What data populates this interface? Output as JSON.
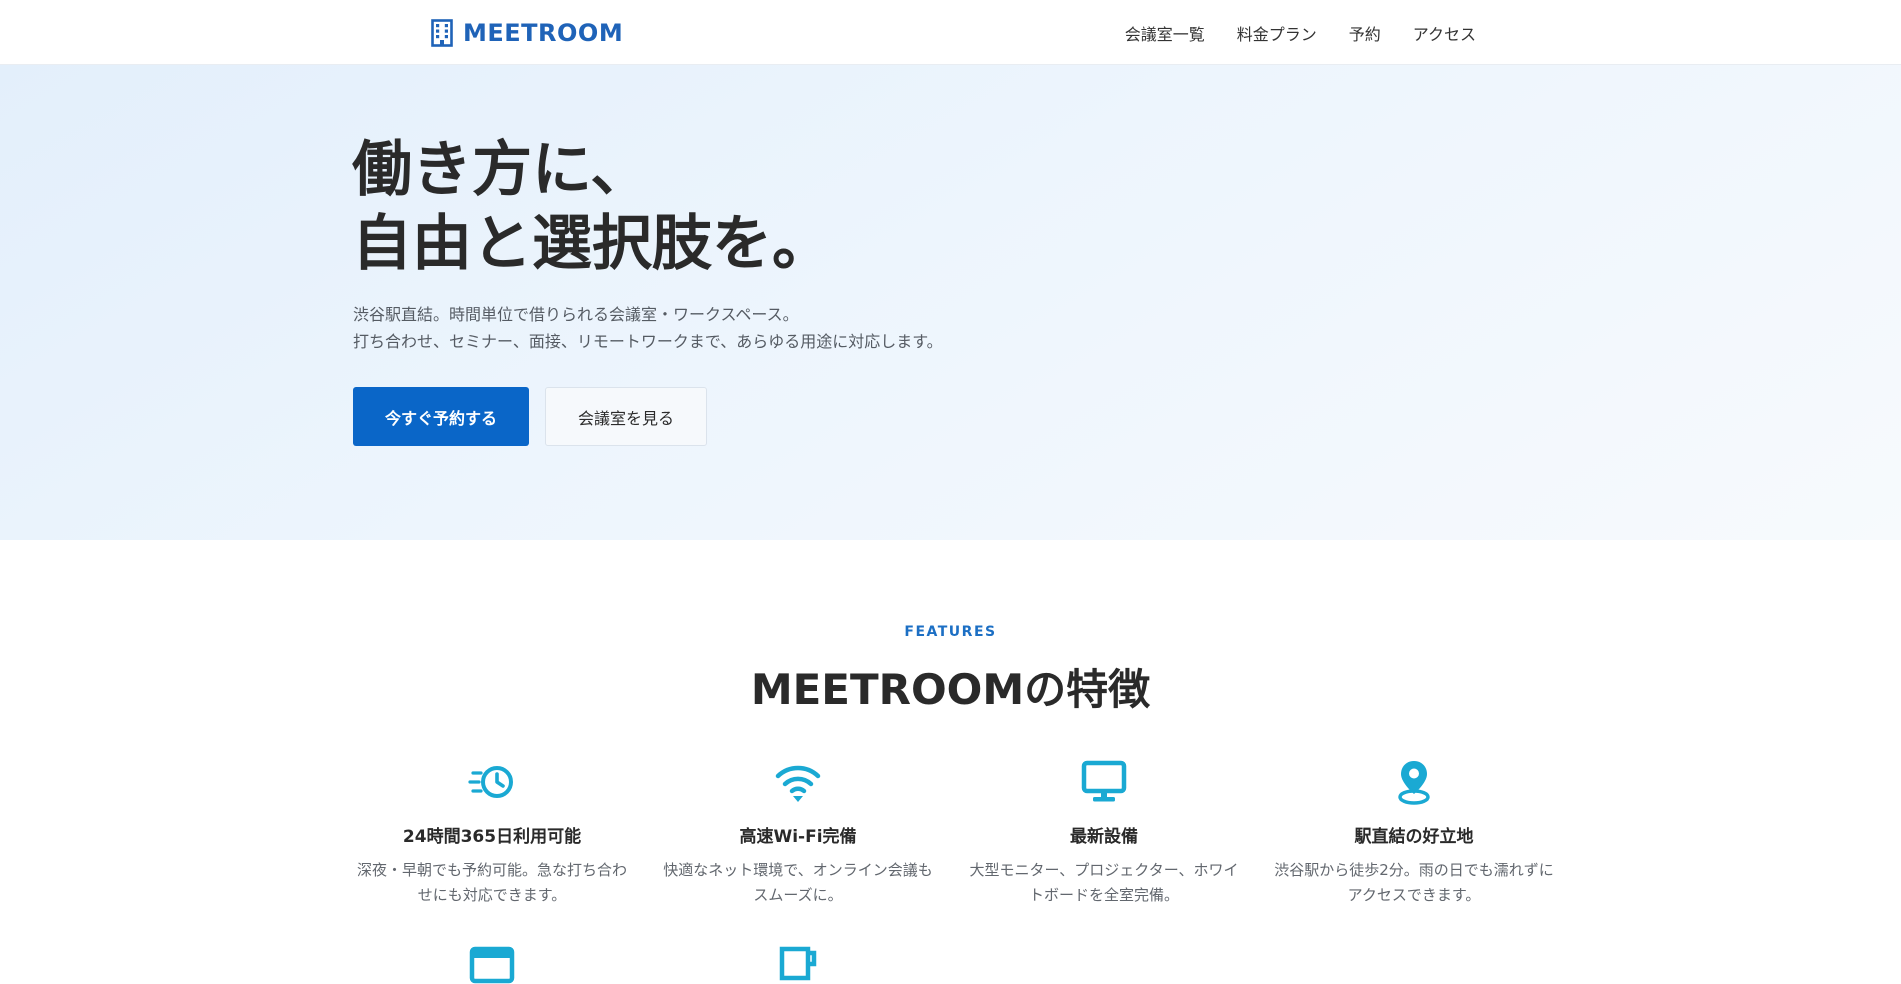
{
  "header": {
    "logo_text": "MEETROOM",
    "nav": [
      "会議室一覧",
      "料金プラン",
      "予約",
      "アクセス"
    ]
  },
  "hero": {
    "title_line1": "働き方に、",
    "title_line2": "自由と選択肢を。",
    "desc_line1": "渋谷駅直結。時間単位で借りられる会議室・ワークスペース。",
    "desc_line2": "打ち合わせ、セミナー、面接、リモートワークまで、あらゆる用途に対応します。",
    "primary_button": "今すぐ予約する",
    "secondary_button": "会議室を見る"
  },
  "features": {
    "eyebrow": "FEATURES",
    "title": "MEETROOMの特徴",
    "items": [
      {
        "icon": "fast-clock-icon",
        "name": "24時間365日利用可能",
        "desc": "深夜・早朝でも予約可能。急な打ち合わせにも対応できます。"
      },
      {
        "icon": "wifi-icon",
        "name": "高速Wi-Fi完備",
        "desc": "快適なネット環境で、オンライン会議もスムーズに。"
      },
      {
        "icon": "monitor-icon",
        "name": "最新設備",
        "desc": "大型モニター、プロジェクター、ホワイトボードを全室完備。"
      },
      {
        "icon": "map-pin-icon",
        "name": "駅直結の好立地",
        "desc": "渋谷駅から徒歩2分。雨の日でも濡れずにアクセスできます。"
      }
    ]
  },
  "colors": {
    "brand": "#1f63b8",
    "primary_button": "#0a66c8",
    "icon_accent": "#1aa9d3",
    "hero_bg": "#e3effb"
  }
}
